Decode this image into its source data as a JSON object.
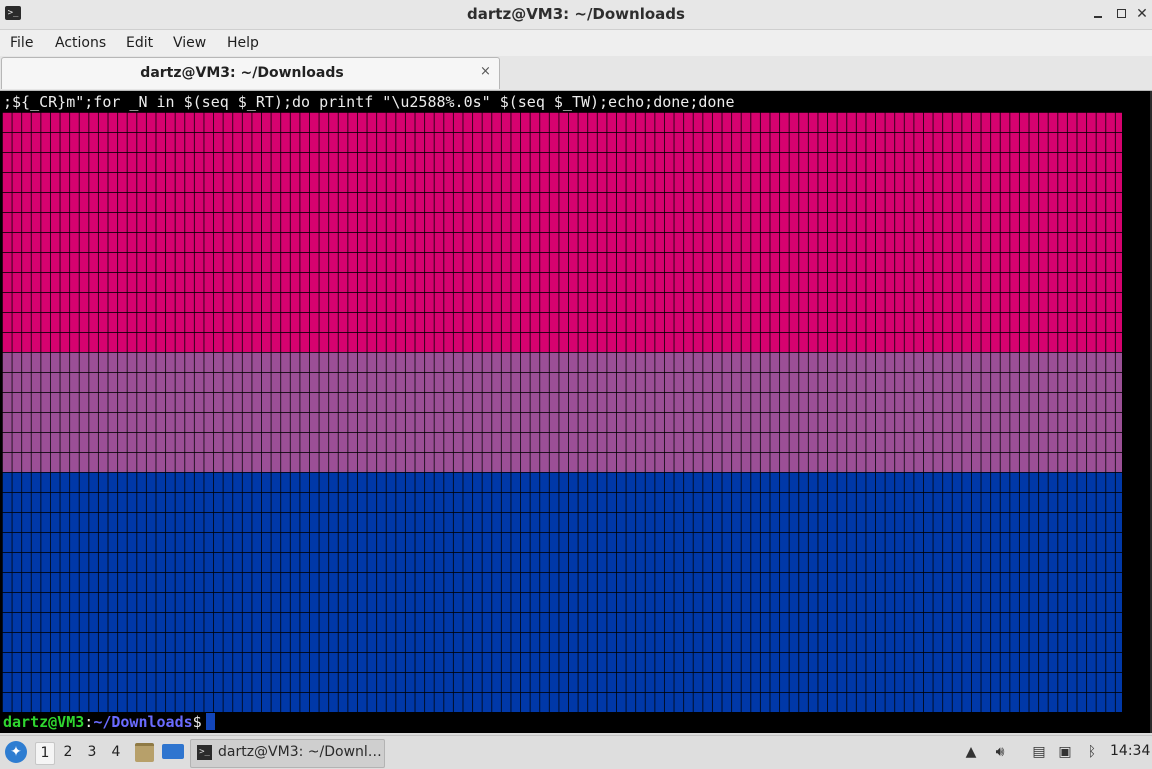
{
  "window": {
    "title": "dartz@VM3: ~/Downloads",
    "icon": "terminal-icon"
  },
  "menubar": {
    "items": [
      {
        "label": "File"
      },
      {
        "label": "Actions"
      },
      {
        "label": "Edit"
      },
      {
        "label": "View"
      },
      {
        "label": "Help"
      }
    ]
  },
  "tab": {
    "label": "dartz@VM3: ~/Downloads",
    "close": "×"
  },
  "terminal": {
    "command_line": ";${_CR}m\";for _N in $(seq $_RT);do printf \"\\u2588%.0s\" $(seq $_TW);echo;done;done",
    "prompt_user": "dartz@VM3",
    "prompt_sep": ":",
    "prompt_path": "~/Downloads",
    "prompt_sign": "$",
    "colors": {
      "pink": "#d6026f",
      "purple": "#9b4f96",
      "blue": "#0038a8",
      "background": "#000000"
    }
  },
  "taskbar": {
    "workspaces": [
      "1",
      "2",
      "3",
      "4"
    ],
    "active_workspace": "1",
    "task_label": "dartz@VM3: ~/Downl…",
    "clock": "14:34",
    "tray_icons": [
      "arrow-up-icon",
      "volume-icon",
      "clipboard-icon",
      "network-icon",
      "bluetooth-icon"
    ]
  }
}
